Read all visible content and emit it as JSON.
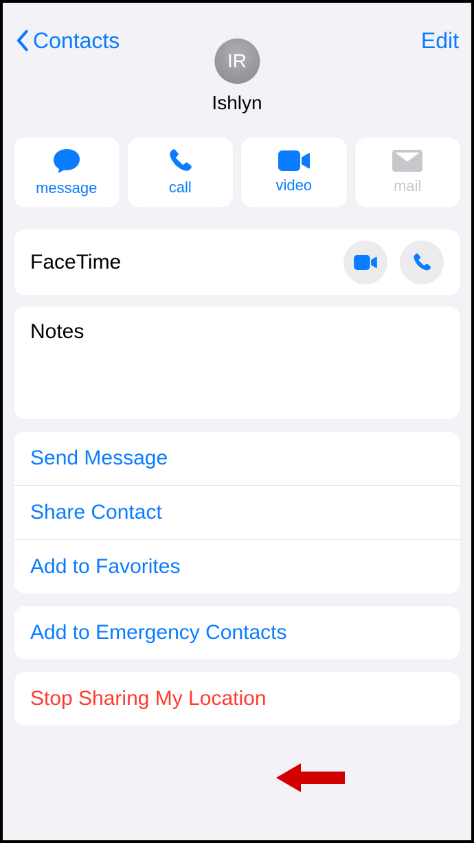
{
  "header": {
    "back_label": "Contacts",
    "edit_label": "Edit"
  },
  "contact": {
    "initials": "IR",
    "name": "Ishlyn"
  },
  "actions": {
    "message": "message",
    "call": "call",
    "video": "video",
    "mail": "mail"
  },
  "facetime": {
    "label": "FaceTime"
  },
  "notes": {
    "label": "Notes"
  },
  "options": {
    "send_message": "Send Message",
    "share_contact": "Share Contact",
    "add_favorites": "Add to Favorites",
    "add_emergency": "Add to Emergency Contacts",
    "stop_sharing": "Stop Sharing My Location"
  }
}
